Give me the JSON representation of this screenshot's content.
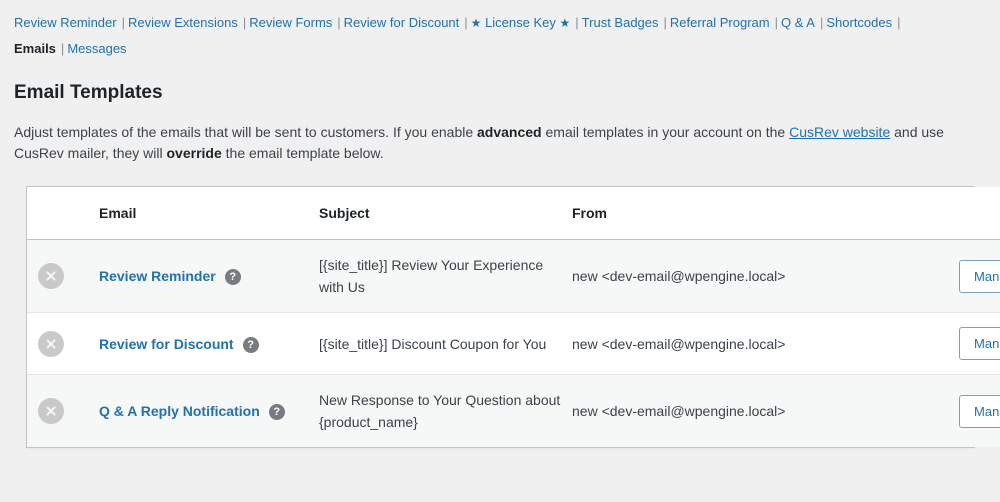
{
  "top_nav": {
    "items": [
      {
        "label": "Review Reminder",
        "starred": false
      },
      {
        "label": "Review Extensions",
        "starred": false
      },
      {
        "label": "Review Forms",
        "starred": false
      },
      {
        "label": "Review for Discount",
        "starred": false
      },
      {
        "label": "License Key",
        "starred": true
      },
      {
        "label": "Trust Badges",
        "starred": false
      },
      {
        "label": "Referral Program",
        "starred": false
      },
      {
        "label": "Q & A",
        "starred": false
      },
      {
        "label": "Shortcodes",
        "starred": false
      }
    ],
    "separator": "|",
    "star_glyph": "★",
    "link_color": "#2271b1"
  },
  "sub_nav": {
    "current": "Emails",
    "separator": "|",
    "items": [
      {
        "label": "Messages"
      }
    ]
  },
  "page": {
    "title": "Email Templates",
    "description_part1": "Adjust templates of the emails that will be sent to customers. If you enable ",
    "description_bold1": "advanced",
    "description_part2": " email templates in your account on the ",
    "description_link": "CusRev website",
    "description_part3": " and use CusRev mailer, they will ",
    "description_bold2": "override",
    "description_part4": " the email template below."
  },
  "table": {
    "columns": {
      "toggle": "",
      "email": "Email",
      "subject": "Subject",
      "from": "From",
      "action": ""
    },
    "rows": [
      {
        "toggle_icon": "disable-icon",
        "name": "Review Reminder",
        "help_icon": "?",
        "subject": "[{site_title}] Review Your Experience with Us",
        "from": "new <dev-email@wpengine.local>",
        "action_label": "Manage"
      },
      {
        "toggle_icon": "disable-icon",
        "name": "Review for Discount",
        "help_icon": "?",
        "subject": "[{site_title}] Discount Coupon for You",
        "from": "new <dev-email@wpengine.local>",
        "action_label": "Manage"
      },
      {
        "toggle_icon": "disable-icon",
        "name": "Q & A Reply Notification",
        "help_icon": "?",
        "subject": "New Response to Your Question about {product_name}",
        "from": "new <dev-email@wpengine.local>",
        "action_label": "Manage"
      }
    ]
  },
  "colors": {
    "page_background": "#f0f0f1",
    "link": "#2271b1",
    "text": "#3c434a",
    "heading": "#1d2327",
    "stripe_row": "#f6f7f7",
    "border": "#c3c4c7",
    "disable_icon": "#c9c9c9",
    "help_icon": "#787c82",
    "button_border": "#7b9fc4"
  }
}
